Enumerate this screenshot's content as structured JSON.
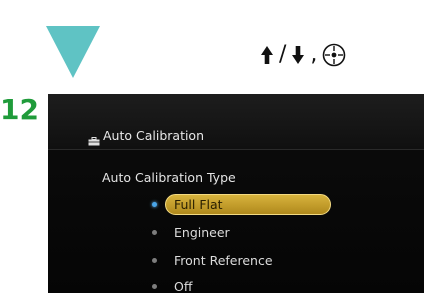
{
  "instruction": {
    "step_number": "12",
    "nav_keys": [
      {
        "icon": "arrow-up-icon"
      },
      {
        "separator": "/"
      },
      {
        "icon": "arrow-down-icon"
      },
      {
        "separator": ","
      },
      {
        "icon": "enter-button-icon"
      }
    ]
  },
  "colors": {
    "triangle": "#5fc3c4",
    "step_number": "#1f9b3a",
    "highlight": "#c9a22c",
    "active_dot": "#4aa6e8"
  },
  "menu": {
    "title_icon": "toolbox-icon",
    "title": "Auto Calibration",
    "section_label": "Auto Calibration Type",
    "options": [
      {
        "label": "Full Flat",
        "selected": true
      },
      {
        "label": "Engineer",
        "selected": false
      },
      {
        "label": "Front Reference",
        "selected": false
      },
      {
        "label": "Off",
        "selected": false
      }
    ]
  }
}
